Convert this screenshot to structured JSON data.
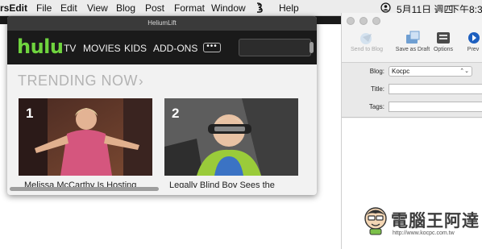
{
  "menubar": {
    "app_name": "rsEdit",
    "items": [
      "File",
      "Edit",
      "View",
      "Blog",
      "Post",
      "Format",
      "Window",
      "Help"
    ],
    "date": "5月11日 週四",
    "time": "下午8:3"
  },
  "helium": {
    "title": "HeliumLift",
    "hulu": {
      "logo": "hulu",
      "nav": [
        "TV",
        "MOVIES",
        "KIDS",
        "ADD-ONS"
      ],
      "more": "•••",
      "section_title": "TRENDING NOW",
      "section_chevron": "›",
      "cards": [
        {
          "rank": "1",
          "caption": "Melissa McCarthy Is Hosting"
        },
        {
          "rank": "2",
          "caption": "Legally Blind Boy Sees the"
        }
      ]
    }
  },
  "marsedit": {
    "toolbar": [
      {
        "label": "Send to Blog",
        "icon": "send-to-blog-icon",
        "disabled": true
      },
      {
        "label": "Save as Draft",
        "icon": "save-as-draft-icon",
        "disabled": false
      },
      {
        "label": "Options",
        "icon": "options-icon",
        "disabled": false
      },
      {
        "label": "Prev",
        "icon": "preview-icon",
        "disabled": false
      }
    ],
    "form": {
      "blog_label": "Blog:",
      "blog_value": "Kocpc",
      "title_label": "Title:",
      "tags_label": "Tags:"
    }
  },
  "watermark": {
    "title": "電腦王阿達",
    "url": "http://www.kocpc.com.tw"
  },
  "colors": {
    "hulu_green": "#6fd43e",
    "menubar_bg": "#ececec"
  }
}
